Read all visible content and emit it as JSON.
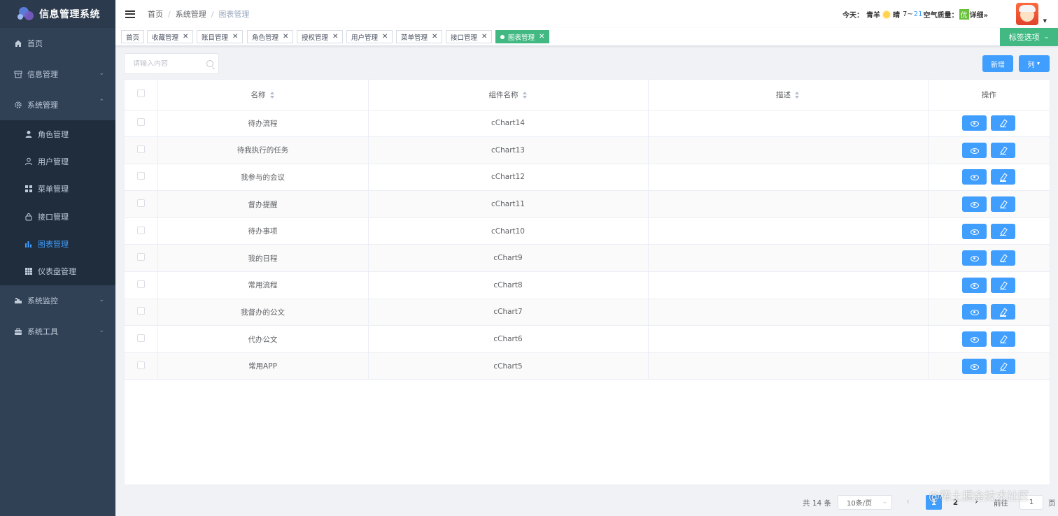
{
  "app": {
    "title": "信息管理系统"
  },
  "sidebar": {
    "items": [
      {
        "label": "首页",
        "icon": "home-icon"
      },
      {
        "label": "信息管理",
        "icon": "archive-icon",
        "expanded": false
      },
      {
        "label": "系统管理",
        "icon": "gear-icon",
        "expanded": true
      },
      {
        "label": "系统监控",
        "icon": "monitor-icon",
        "expanded": false
      },
      {
        "label": "系统工具",
        "icon": "toolbox-icon",
        "expanded": false
      }
    ],
    "sub_items": [
      {
        "label": "角色管理",
        "icon": "user-icon",
        "active": false
      },
      {
        "label": "用户管理",
        "icon": "user-outline-icon",
        "active": false
      },
      {
        "label": "菜单管理",
        "icon": "grid-icon",
        "active": false
      },
      {
        "label": "接口管理",
        "icon": "lock-icon",
        "active": false
      },
      {
        "label": "图表管理",
        "icon": "bar-chart-icon",
        "active": true
      },
      {
        "label": "仪表盘管理",
        "icon": "dashboard-grid-icon",
        "active": false
      }
    ]
  },
  "breadcrumb": [
    "首页",
    "系统管理",
    "图表管理"
  ],
  "weather": {
    "today_label": "今天：",
    "city": "青羊",
    "condition": "晴",
    "temp_low": "7~",
    "temp_high": "21",
    "aqi_label": "空气质量：",
    "aqi_value": "优",
    "detail": "详细»"
  },
  "tags": [
    {
      "label": "首页",
      "closable": false,
      "active": false
    },
    {
      "label": "收藏管理",
      "closable": true,
      "active": false
    },
    {
      "label": "账目管理",
      "closable": true,
      "active": false
    },
    {
      "label": "角色管理",
      "closable": true,
      "active": false
    },
    {
      "label": "授权管理",
      "closable": true,
      "active": false
    },
    {
      "label": "用户管理",
      "closable": true,
      "active": false
    },
    {
      "label": "菜单管理",
      "closable": true,
      "active": false
    },
    {
      "label": "接口管理",
      "closable": true,
      "active": false
    },
    {
      "label": "图表管理",
      "closable": true,
      "active": true
    }
  ],
  "tag_options": {
    "label": "标签选项"
  },
  "search": {
    "placeholder": "请输入内容",
    "value": ""
  },
  "toolbar": {
    "add_label": "新增",
    "columns_label": "列"
  },
  "table": {
    "columns": [
      "名称",
      "组件名称",
      "描述",
      "操作"
    ],
    "rows": [
      {
        "name": "待办流程",
        "component": "cChart14",
        "desc": ""
      },
      {
        "name": "待我执行的任务",
        "component": "cChart13",
        "desc": ""
      },
      {
        "name": "我参与的会议",
        "component": "cChart12",
        "desc": ""
      },
      {
        "name": "督办提醒",
        "component": "cChart11",
        "desc": ""
      },
      {
        "name": "待办事项",
        "component": "cChart10",
        "desc": ""
      },
      {
        "name": "我的日程",
        "component": "cChart9",
        "desc": ""
      },
      {
        "name": "常用流程",
        "component": "cChart8",
        "desc": ""
      },
      {
        "name": "我督办的公文",
        "component": "cChart7",
        "desc": ""
      },
      {
        "name": "代办公文",
        "component": "cChart6",
        "desc": ""
      },
      {
        "name": "常用APP",
        "component": "cChart5",
        "desc": ""
      }
    ]
  },
  "pagination": {
    "total_text": "共 14 条",
    "page_size": "10条/页",
    "pages": [
      "1",
      "2"
    ],
    "current": "1",
    "goto_label": "前往",
    "goto_value": "1",
    "unit": "页"
  },
  "watermark": "@稀土掘金技术社区",
  "colors": {
    "sidebar_bg": "#304156",
    "submenu_bg": "#1f2d3d",
    "primary": "#409eff",
    "tag_active": "#42b983"
  }
}
